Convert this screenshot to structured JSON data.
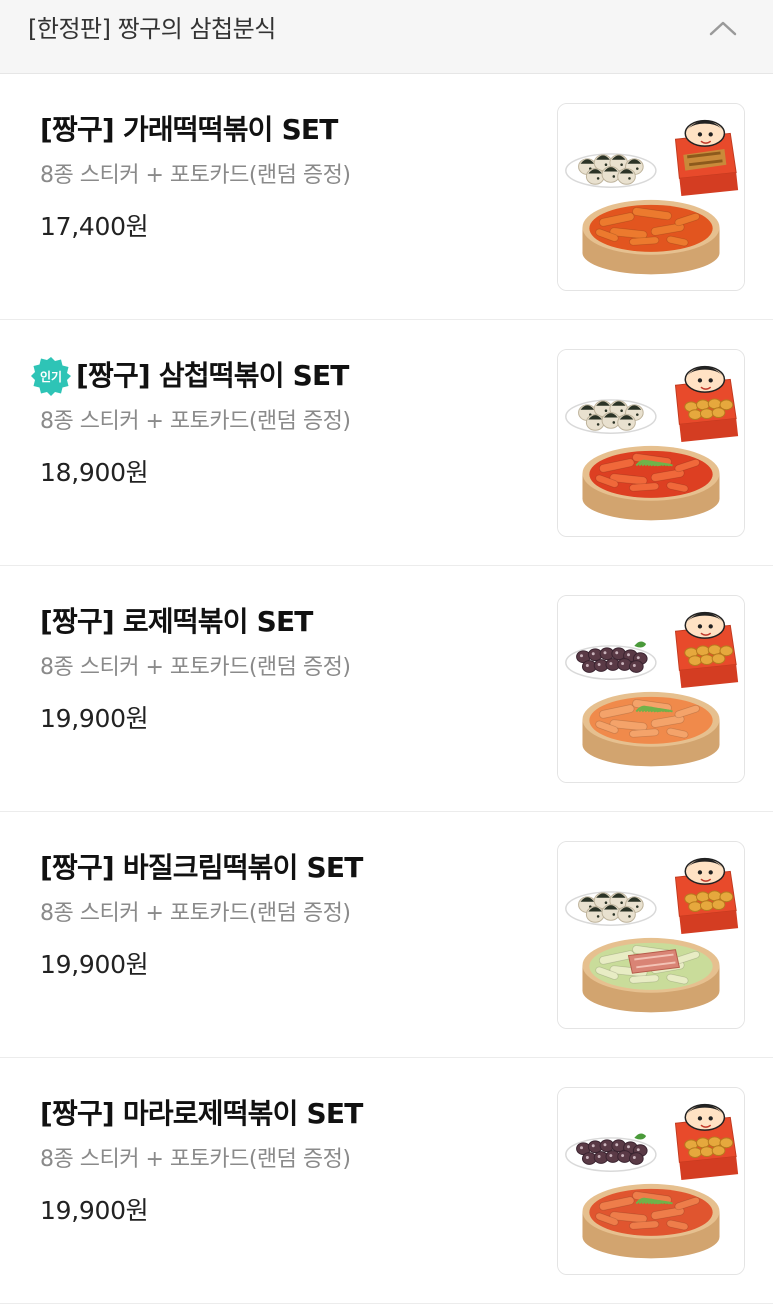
{
  "section": {
    "title": "[한정판] 짱구의 삼첩분식",
    "toggle_icon": "chevron-up-icon"
  },
  "badges": {
    "popular": "인기"
  },
  "colors": {
    "header_bg": "#f6f6f6",
    "badge_teal": "#2ec4b6",
    "desc_gray": "#8a8a8a",
    "divider": "#ececec"
  },
  "items": [
    {
      "name": "[짱구] 가래떡떡볶이 SET",
      "desc": "8종 스티커 + 포토카드(랜덤 증정)",
      "price": "17,400원",
      "popular": false,
      "side_dish": "rice-balls",
      "sauce": "#e2551f",
      "rice_cake": "#ec7a2e",
      "topping": "none",
      "box_food": "fritters",
      "image_icon": "garaetteok-tteokbokki-set-image"
    },
    {
      "name": "[짱구] 삼첩떡볶이 SET",
      "desc": "8종 스티커 + 포토카드(랜덤 증정)",
      "price": "18,900원",
      "popular": true,
      "side_dish": "rice-balls",
      "sauce": "#dd3f22",
      "rice_cake": "#f0683a",
      "topping": "green-onion",
      "box_food": "nuggets",
      "image_icon": "samcheop-tteokbokki-set-image"
    },
    {
      "name": "[짱구] 로제떡볶이 SET",
      "desc": "8종 스티커 + 포토카드(랜덤 증정)",
      "price": "19,900원",
      "popular": false,
      "side_dish": "sundae",
      "sauce": "#f08a4b",
      "rice_cake": "#f4a36a",
      "topping": "green-onion",
      "box_food": "nuggets",
      "image_icon": "rose-tteokbokki-set-image"
    },
    {
      "name": "[짱구] 바질크림떡볶이 SET",
      "desc": "8종 스티커 + 포토카드(랜덤 증정)",
      "price": "19,900원",
      "popular": false,
      "side_dish": "rice-balls",
      "sauce": "#c9dc9a",
      "rice_cake": "#e8ecc4",
      "topping": "bacon",
      "box_food": "nuggets",
      "image_icon": "basil-cream-tteokbokki-set-image"
    },
    {
      "name": "[짱구] 마라로제떡볶이 SET",
      "desc": "8종 스티커 + 포토카드(랜덤 증정)",
      "price": "19,900원",
      "popular": false,
      "side_dish": "sundae",
      "sauce": "#e0552f",
      "rice_cake": "#ee7d4a",
      "topping": "green-onion",
      "box_food": "nuggets",
      "image_icon": "mala-rose-tteokbokki-set-image"
    }
  ]
}
